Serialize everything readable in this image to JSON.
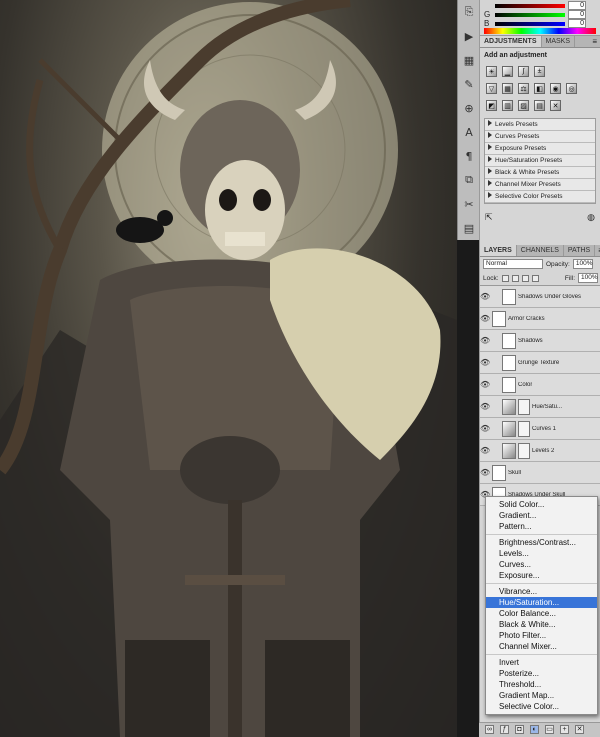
{
  "color_panel": {
    "channels": [
      {
        "label": "",
        "value": "0"
      },
      {
        "label": "G",
        "value": "0"
      },
      {
        "label": "B",
        "value": "0"
      }
    ]
  },
  "adjustments": {
    "tabs": [
      "ADJUSTMENTS",
      "MASKS"
    ],
    "title": "Add an adjustment",
    "row1_icons": [
      "brightness-contrast-icon",
      "levels-icon",
      "curves-icon",
      "exposure-icon"
    ],
    "row2_icons": [
      "vibrance-icon",
      "hue-saturation-icon",
      "color-balance-icon",
      "black-white-icon",
      "photo-filter-icon",
      "channel-mixer-icon"
    ],
    "row3_icons": [
      "invert-icon",
      "posterize-icon",
      "threshold-icon",
      "gradient-map-icon",
      "selective-color-icon"
    ],
    "presets": [
      "Levels Presets",
      "Curves Presets",
      "Exposure Presets",
      "Hue/Saturation Presets",
      "Black & White Presets",
      "Channel Mixer Presets",
      "Selective Color Presets"
    ]
  },
  "layers": {
    "tabs": [
      "LAYERS",
      "CHANNELS",
      "PATHS"
    ],
    "blend_mode": "Normal",
    "opacity_label": "Opacity:",
    "opacity": "100%",
    "lock_label": "Lock:",
    "fill_label": "Fill:",
    "fill": "100%",
    "items": [
      {
        "name": "Shadows Under Gloves",
        "indent": 1,
        "adj": false,
        "mask": false
      },
      {
        "name": "Armor Cracks",
        "indent": 0,
        "adj": false,
        "mask": false
      },
      {
        "name": "Shadows",
        "indent": 1,
        "adj": false,
        "mask": false
      },
      {
        "name": "Grunge Texture",
        "indent": 1,
        "adj": false,
        "mask": false
      },
      {
        "name": "Color",
        "indent": 1,
        "adj": false,
        "mask": false
      },
      {
        "name": "Hue/Satu...",
        "indent": 1,
        "adj": true,
        "mask": true
      },
      {
        "name": "Curves 1",
        "indent": 1,
        "adj": true,
        "mask": true
      },
      {
        "name": "Levels 2",
        "indent": 1,
        "adj": true,
        "mask": true
      },
      {
        "name": "Skull",
        "indent": 0,
        "adj": false,
        "mask": false
      },
      {
        "name": "Shadows Under Skull",
        "indent": 0,
        "adj": false,
        "mask": false
      }
    ]
  },
  "menu": {
    "groups": [
      [
        "Solid Color...",
        "Gradient...",
        "Pattern..."
      ],
      [
        "Brightness/Contrast...",
        "Levels...",
        "Curves...",
        "Exposure..."
      ],
      [
        "Vibrance...",
        "Hue/Saturation...",
        "Color Balance...",
        "Black & White...",
        "Photo Filter...",
        "Channel Mixer..."
      ],
      [
        "Invert",
        "Posterize...",
        "Threshold...",
        "Gradient Map...",
        "Selective Color..."
      ]
    ],
    "selected": "Hue/Saturation..."
  },
  "colors": {
    "menu_highlight": "#3874d8",
    "panel_bg": "#d6d6d6"
  }
}
